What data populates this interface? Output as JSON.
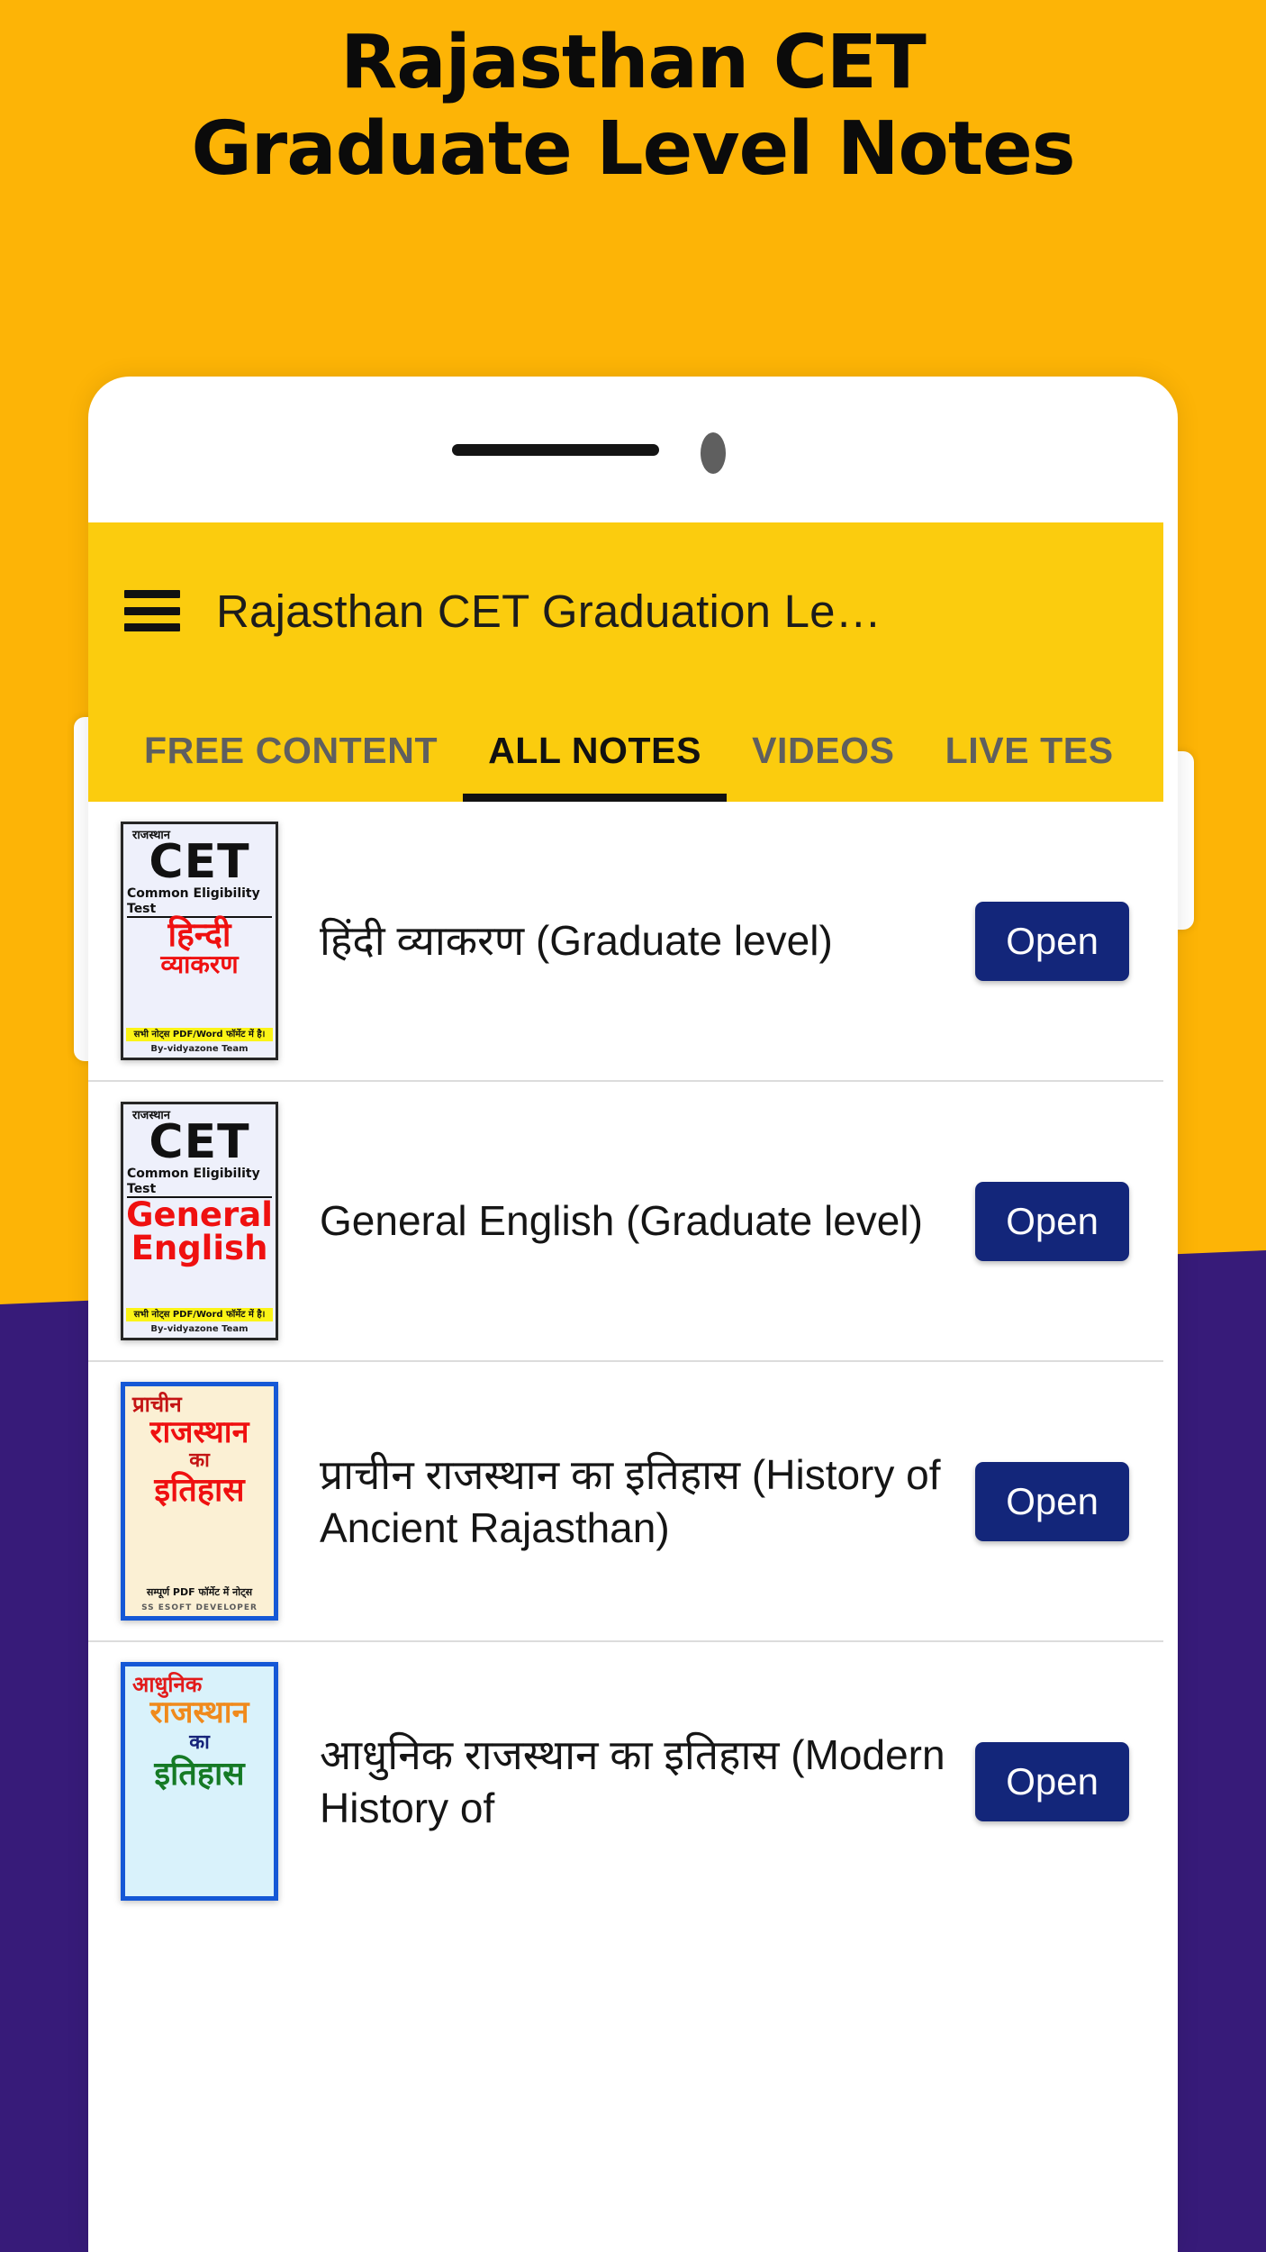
{
  "promo": {
    "line1": "Rajasthan CET",
    "line2": "Graduate Level Notes"
  },
  "colors": {
    "background_yellow": "#FDB406",
    "appbar_yellow": "#FBCC0E",
    "background_purple": "#371B79",
    "open_button_navy": "#13267A",
    "tab_active": "#111111",
    "tab_inactive": "#5F5F5F"
  },
  "appbar": {
    "menu_icon": "hamburger-menu-icon",
    "title": "Rajasthan CET Graduation Le…"
  },
  "tabs": [
    {
      "label": "FREE CONTENT",
      "active": false
    },
    {
      "label": "ALL NOTES",
      "active": true
    },
    {
      "label": "VIDEOS",
      "active": false
    },
    {
      "label": "LIVE TES",
      "active": false
    }
  ],
  "notes": [
    {
      "title": "हिंदी व्याकरण (Graduate level)",
      "button": "Open",
      "thumb": {
        "style": "cet",
        "small": "राजस्थान",
        "cet": "CET",
        "sub": "Common Eligibility Test",
        "red_line1": "हिन्दी",
        "red_line2": "व्याकरण",
        "banner": "सभी नोट्स PDF/Word फॉर्मेट में है।",
        "by": "By-vidyazone Team"
      }
    },
    {
      "title": "General English (Graduate level)",
      "button": "Open",
      "thumb": {
        "style": "cet",
        "small": "राजस्थान",
        "cet": "CET",
        "sub": "Common Eligibility Test",
        "red_line1": "General",
        "red_line2": "English",
        "banner": "सभी नोट्स PDF/Word फॉर्मेट में है।",
        "by": "By-vidyazone Team"
      }
    },
    {
      "title": "प्राचीन राजस्थान का इतिहास (History of Ancient Rajasthan)",
      "button": "Open",
      "thumb": {
        "style": "hist-a",
        "l1": "प्राचीन",
        "l2": "राजस्थान",
        "l3": "का",
        "l4": "इतिहास",
        "note": "सम्पूर्ण PDF फॉर्मेट में नोट्स",
        "dev": "SS ESOFT DEVELOPER"
      }
    },
    {
      "title": "आधुनिक राजस्थान का इतिहास (Modern History of",
      "button": "Open",
      "thumb": {
        "style": "hist-m",
        "l1": "आधुनिक",
        "l2": "राजस्थान",
        "l3": "का",
        "l4": "इतिहास"
      }
    }
  ]
}
